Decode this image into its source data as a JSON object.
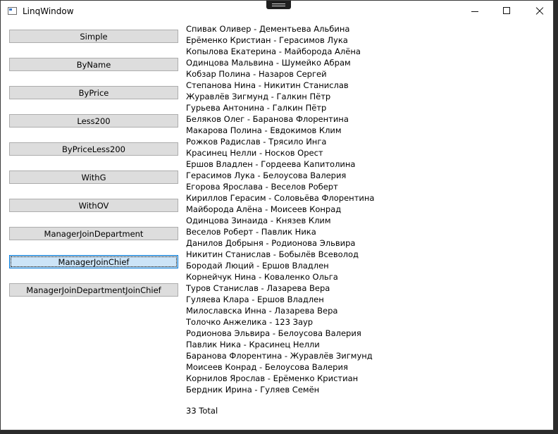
{
  "window": {
    "title": "LinqWindow",
    "icon": "app-window-icon"
  },
  "buttons": [
    {
      "label": "Simple"
    },
    {
      "label": "ByName"
    },
    {
      "label": "ByPrice"
    },
    {
      "label": "Less200"
    },
    {
      "label": "ByPriceLess200"
    },
    {
      "label": "WithG"
    },
    {
      "label": "WithOV"
    },
    {
      "label": "ManagerJoinDepartment"
    },
    {
      "label": "ManagerJoinChief",
      "focused": true
    },
    {
      "label": "ManagerJoinDepartmentJoinChief"
    }
  ],
  "results": [
    "Спивак Оливер - Дементьева Альбина",
    "Ерёменко Кристиан - Герасимов Лука",
    "Копылова Екатерина - Майборода Алёна",
    "Одинцова Мальвина - Шумейко Абрам",
    "Кобзар Полина - Назаров Сергей",
    "Степанова Нина - Никитин Станислав",
    "Журавлёв Зигмунд - Галкин Пётр",
    "Гурьева Антонина - Галкин Пётр",
    "Беляков Олег - Баранова Флорентина",
    "Макарова Полина - Евдокимов Клим",
    "Рожков Радислав - Трясило Инга",
    "Красинец Нелли - Носков Орест",
    "Ершов Владлен - Гордеева Капитолина",
    "Герасимов Лука - Белоусова Валерия",
    "Егорова Ярослава - Веселов Роберт",
    "Кириллов Герасим - Соловьёва Флорентина",
    "Майборода Алёна - Моисеев Конрад",
    "Одинцова Зинаида - Князев Клим",
    "Веселов Роберт - Павлик Ника",
    "Данилов Добрыня - Родионова Эльвира",
    "Никитин Станислав - Бобылёв Всеволод",
    "Бородай Люций - Ершов Владлен",
    "Корнейчук Нина - Коваленко Ольга",
    "Туров Станислав - Лазарева Вера",
    "Гуляева Клара - Ершов Владлен",
    "Милославска Инна - Лазарева Вера",
    "Толочко Анжелика - 123 Заур",
    "Родионова Эльвира - Белоусова Валерия",
    "Павлик Ника - Красинец Нелли",
    "Баранова Флорентина - Журавлёв Зигмунд",
    "Моисеев Конрад - Белоусова Валерия",
    "Корнилов Ярослав - Ерёменко Кристиан",
    "Бердник Ирина - Гуляев Семён"
  ],
  "total": "33 Total"
}
